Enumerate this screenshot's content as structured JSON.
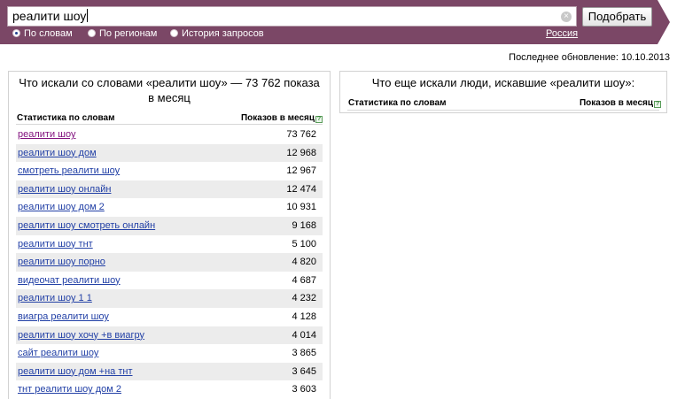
{
  "search": {
    "query": "реалити шоу",
    "button_label": "Подобрать",
    "modes": [
      {
        "label": "По словам",
        "selected": true
      },
      {
        "label": "По регионам",
        "selected": false
      },
      {
        "label": "История запросов",
        "selected": false
      }
    ],
    "region": "Россия"
  },
  "last_update": "Последнее обновление: 10.10.2013",
  "left_panel": {
    "title": "Что искали со словами «реалити шоу» — 73 762 показа в месяц",
    "col_words": "Статистика по словам",
    "col_shows": "Показов в месяц",
    "rows": [
      {
        "phrase": "реалити шоу",
        "count": "73 762"
      },
      {
        "phrase": "реалити шоу дом",
        "count": "12 968"
      },
      {
        "phrase": "смотреть реалити шоу",
        "count": "12 967"
      },
      {
        "phrase": "реалити шоу онлайн",
        "count": "12 474"
      },
      {
        "phrase": "реалити шоу дом 2",
        "count": "10 931"
      },
      {
        "phrase": "реалити шоу смотреть онлайн",
        "count": "9 168"
      },
      {
        "phrase": "реалити шоу тнт",
        "count": "5 100"
      },
      {
        "phrase": "реалити шоу порно",
        "count": "4 820"
      },
      {
        "phrase": "видеочат реалити шоу",
        "count": "4 687"
      },
      {
        "phrase": "реалити шоу 1 1",
        "count": "4 232"
      },
      {
        "phrase": "виагра реалити шоу",
        "count": "4 128"
      },
      {
        "phrase": "реалити шоу хочу +в виагру",
        "count": "4 014"
      },
      {
        "phrase": "сайт реалити шоу",
        "count": "3 865"
      },
      {
        "phrase": "реалити шоу дом +на тнт",
        "count": "3 645"
      },
      {
        "phrase": "тнт реалити шоу дом 2",
        "count": "3 603"
      }
    ]
  },
  "right_panel": {
    "title": "Что еще искали люди, искавшие «реалити шоу»:",
    "col_words": "Статистика по словам",
    "col_shows": "Показов в месяц"
  },
  "colors": {
    "band": "#7b4766",
    "link": "#2240a6",
    "visited_link": "#83137f",
    "row_alt": "#ececec"
  }
}
